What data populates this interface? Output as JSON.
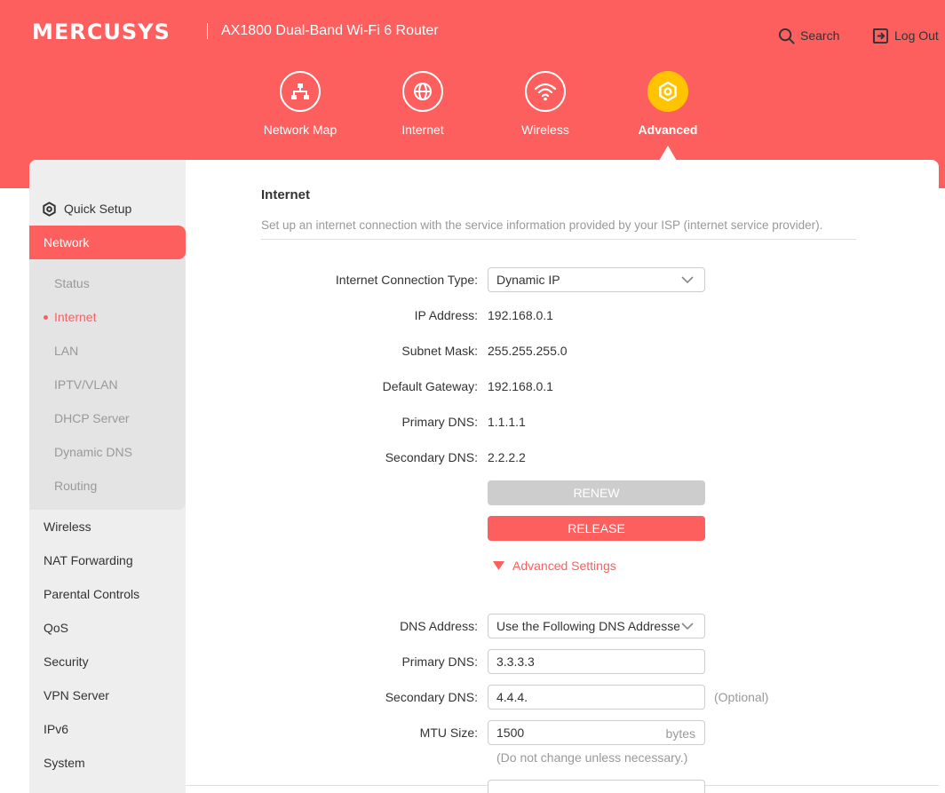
{
  "header": {
    "brand": "MERCUSYS",
    "model": "AX1800 Dual-Band Wi-Fi 6 Router",
    "search_label": "Search",
    "logout_label": "Log Out",
    "color": "#fd5e5e"
  },
  "nav": {
    "items": [
      {
        "label": "Network Map",
        "icon": "network-map-icon"
      },
      {
        "label": "Internet",
        "icon": "globe-icon"
      },
      {
        "label": "Wireless",
        "icon": "wifi-icon"
      },
      {
        "label": "Advanced",
        "icon": "gear-icon",
        "active": true
      }
    ],
    "active_color": "#ffc300"
  },
  "sidebar": {
    "quick_setup": "Quick Setup",
    "network": "Network",
    "network_sub": [
      "Status",
      "Internet",
      "LAN",
      "IPTV/VLAN",
      "DHCP Server",
      "Dynamic DNS",
      "Routing"
    ],
    "active_sub": "Internet",
    "items": [
      "Wireless",
      "NAT Forwarding",
      "Parental Controls",
      "QoS",
      "Security",
      "VPN Server",
      "IPv6",
      "System"
    ]
  },
  "main": {
    "title": "Internet",
    "description": "Set up an internet connection with the service information provided by your ISP (internet service provider).",
    "connection_type": {
      "label": "Internet Connection Type:",
      "value": "Dynamic IP"
    },
    "ip_address": {
      "label": "IP Address:",
      "value": "192.168.0.1"
    },
    "subnet_mask": {
      "label": "Subnet Mask:",
      "value": "255.255.255.0"
    },
    "default_gateway": {
      "label": "Default Gateway:",
      "value": "192.168.0.1"
    },
    "primary_dns_info": {
      "label": "Primary DNS:",
      "value": "1.1.1.1"
    },
    "secondary_dns_info": {
      "label": "Secondary DNS:",
      "value": "2.2.2.2"
    },
    "renew_label": "RENEW",
    "release_label": "RELEASE",
    "advanced_settings_label": "Advanced Settings",
    "dns_address": {
      "label": "DNS Address:",
      "value": "Use the Following DNS Addresses"
    },
    "primary_dns": {
      "label": "Primary DNS:",
      "value": "3.3.3.3"
    },
    "secondary_dns": {
      "label": "Secondary DNS:",
      "value": "4.4.4.",
      "note": "(Optional)"
    },
    "mtu": {
      "label": "MTU Size:",
      "value": "1500",
      "unit": "bytes",
      "note": "(Do not change unless necessary.)"
    }
  }
}
